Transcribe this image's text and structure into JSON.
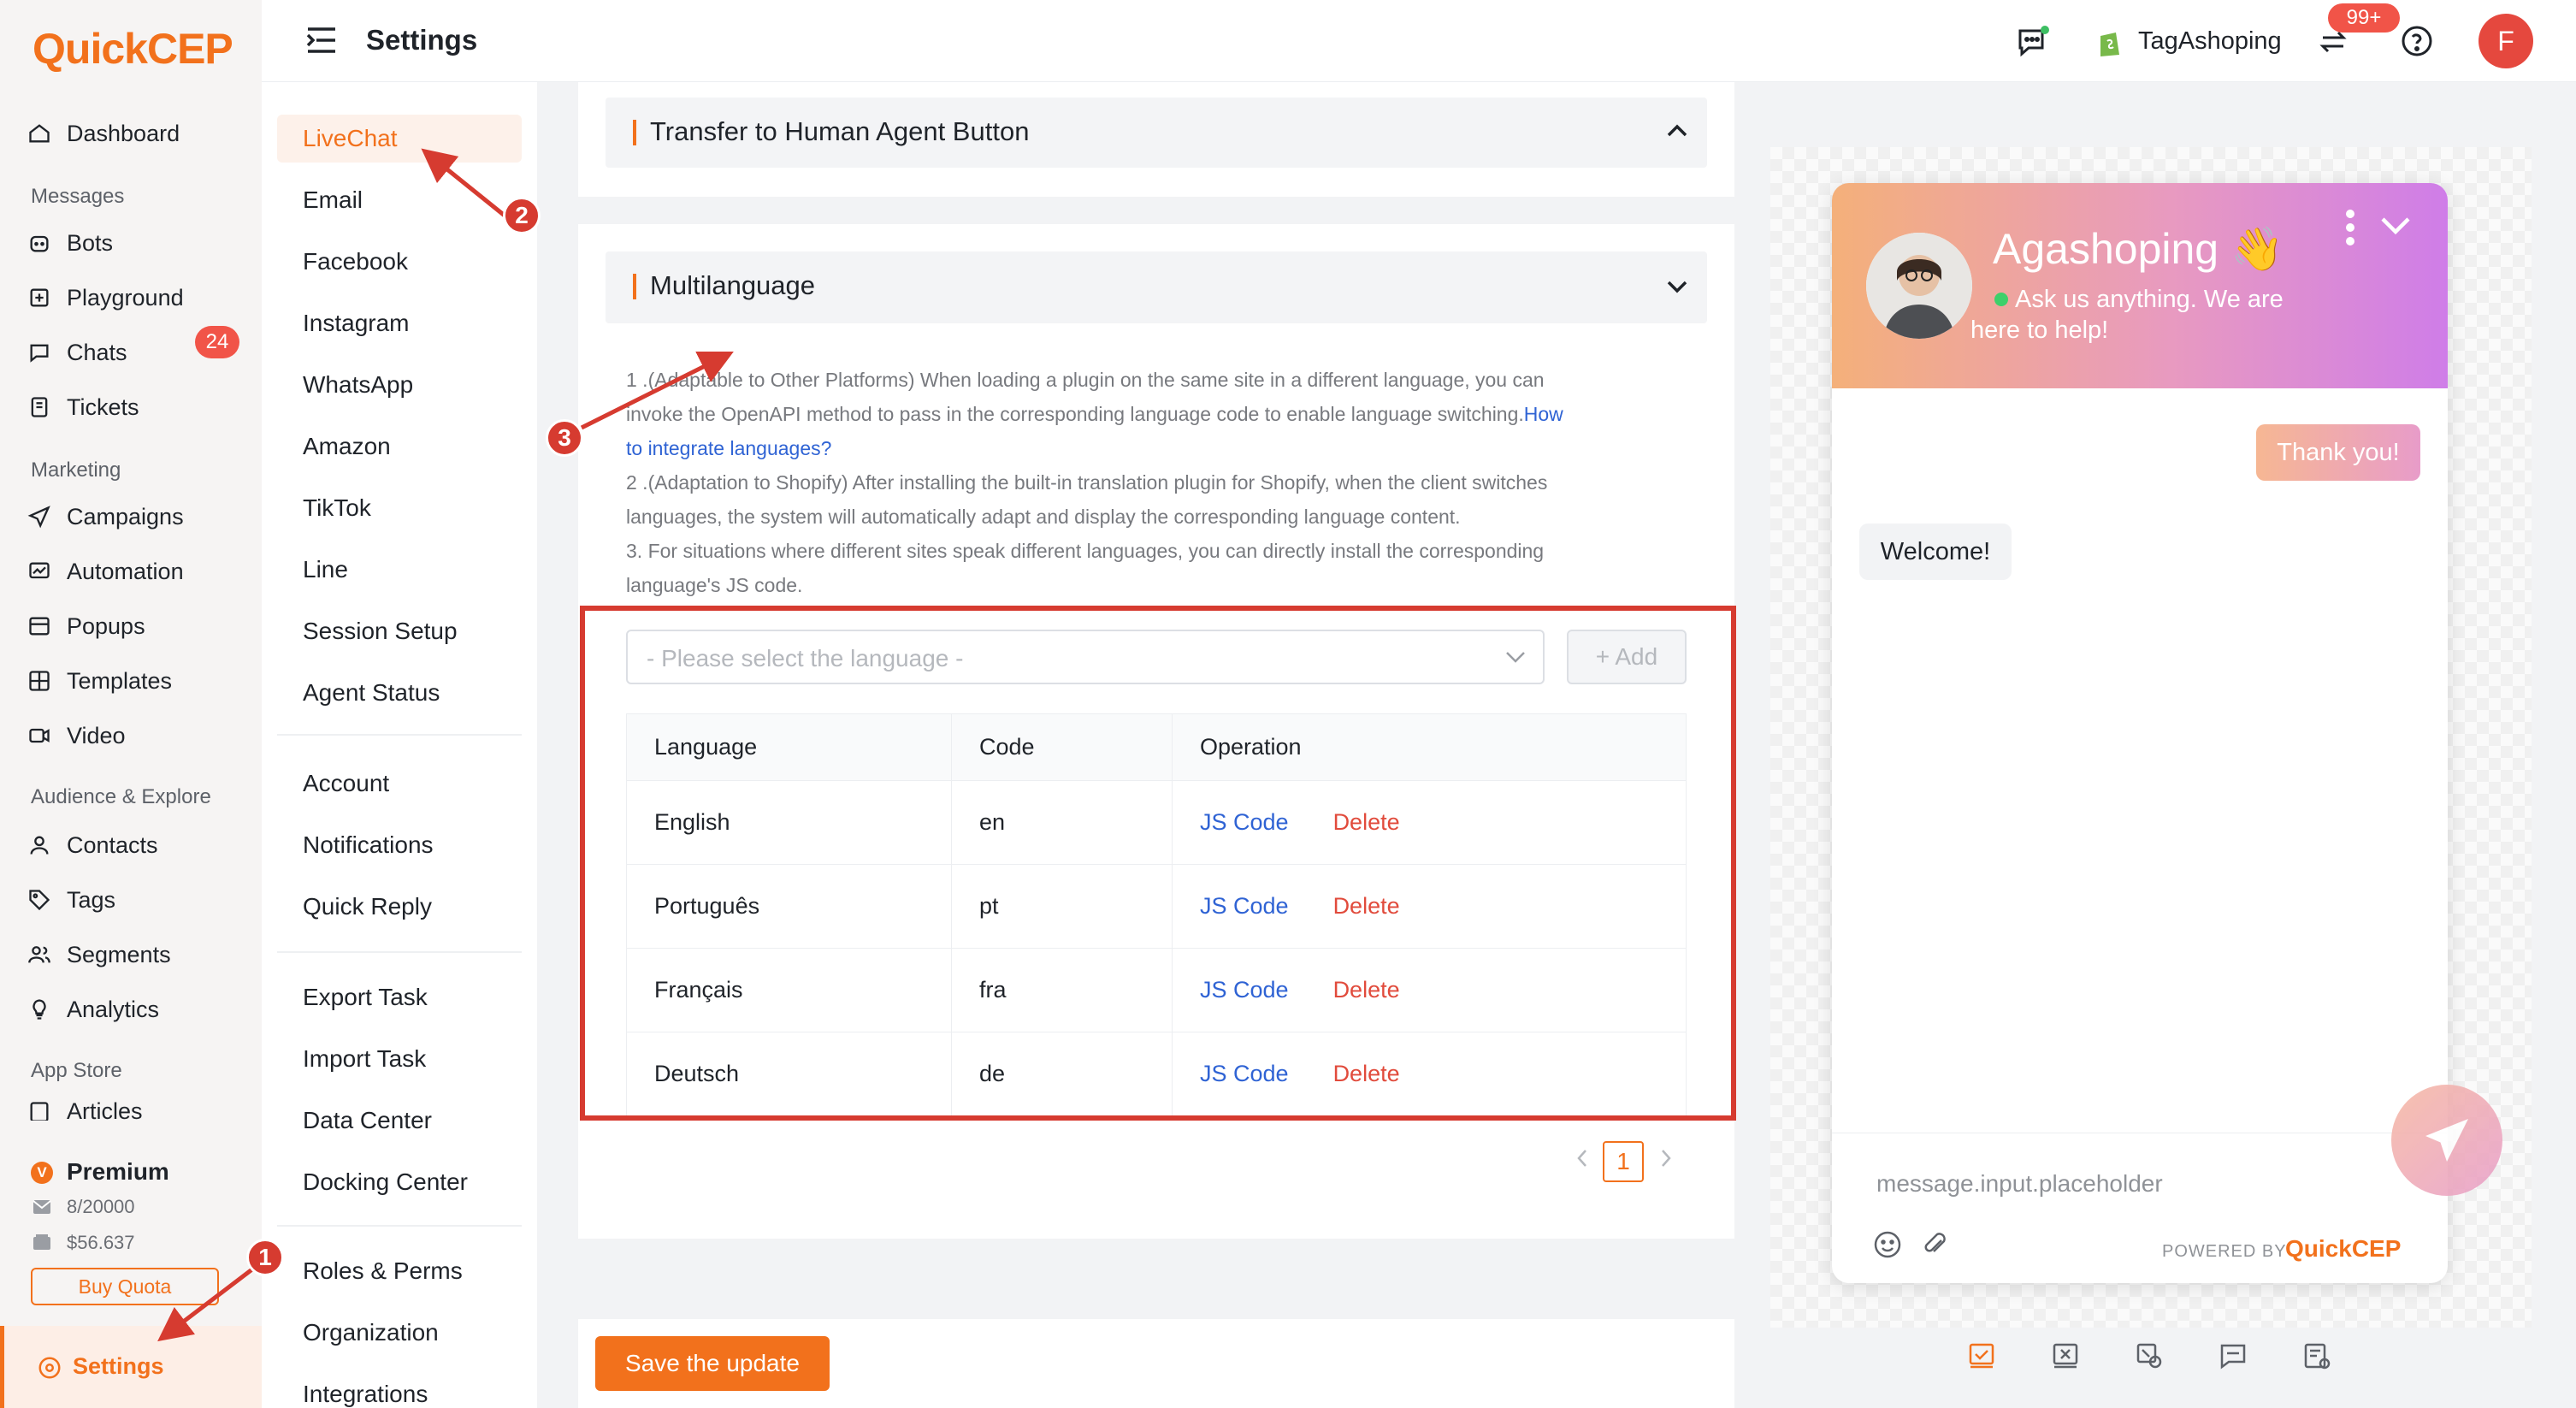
{
  "app": {
    "logo_first": "Q",
    "logo_mid": "uick",
    "logo_end": "CEP",
    "page_title": "Settings"
  },
  "leftnav": {
    "dashboard": "Dashboard",
    "sec_messages": "Messages",
    "bots": "Bots",
    "playground": "Playground",
    "chats": "Chats",
    "chats_badge": "24",
    "tickets": "Tickets",
    "sec_marketing": "Marketing",
    "campaigns": "Campaigns",
    "automation": "Automation",
    "popups": "Popups",
    "templates": "Templates",
    "video": "Video",
    "sec_audience": "Audience & Explore",
    "contacts": "Contacts",
    "tags": "Tags",
    "segments": "Segments",
    "analytics": "Analytics",
    "sec_appstore": "App Store",
    "articles": "Articles",
    "plan": "Premium",
    "quota_msgs": "8/20000",
    "quota_money": "$56.637",
    "buy_quota": "Buy Quota",
    "settings": "Settings"
  },
  "topbar": {
    "shop": "TagAshoping",
    "notif_badge": "99+",
    "avatar": "F"
  },
  "subnav": {
    "livechat": "LiveChat",
    "email": "Email",
    "facebook": "Facebook",
    "instagram": "Instagram",
    "whatsapp": "WhatsApp",
    "amazon": "Amazon",
    "tiktok": "TikTok",
    "line": "Line",
    "session": "Session Setup",
    "agent_status": "Agent Status",
    "account": "Account",
    "notifications": "Notifications",
    "quick_reply": "Quick Reply",
    "export": "Export Task",
    "import": "Import Task",
    "data_center": "Data Center",
    "docking": "Docking Center",
    "roles": "Roles & Perms",
    "org": "Organization",
    "integrations": "Integrations"
  },
  "main": {
    "transfer_title": "Transfer to Human Agent Button",
    "multi_title": "Multilanguage",
    "p1a": "1 .(Adaptable to Other Platforms) When loading a plugin on the same site in a different language, you can",
    "p1b": "invoke the OpenAPI method to pass in the corresponding language code to enable language switching.",
    "p1link_a": "How",
    "p1link_b": "to integrate languages?",
    "p2a": "2 .(Adaptation to Shopify) After installing the built-in translation plugin for Shopify, when the client switches",
    "p2b": "languages, the system will automatically adapt and display the corresponding language content.",
    "p3a": "3. For situations where different sites speak different languages, you can directly install the corresponding",
    "p3b": "language's JS code.",
    "select_placeholder": "- Please select the language -",
    "add_btn": "+ Add",
    "col_language": "Language",
    "col_code": "Code",
    "col_operation": "Operation",
    "rows": [
      {
        "lang": "English",
        "code": "en"
      },
      {
        "lang": "Português",
        "code": "pt"
      },
      {
        "lang": "Français",
        "code": "fra"
      },
      {
        "lang": "Deutsch",
        "code": "de"
      }
    ],
    "js_code": "JS Code",
    "delete": "Delete",
    "page": "1",
    "save": "Save the update"
  },
  "widget": {
    "name": "Agashoping 👋",
    "subtitle_a": "Ask us anything. We are",
    "subtitle_b": "here to help!",
    "msg_out": "Thank you!",
    "msg_in": "Welcome!",
    "input_placeholder": "message.input.placeholder",
    "powered_by": "POWERED BY",
    "brand_first": "Q",
    "brand_rest": "uick",
    "brand_end": "CEP"
  },
  "annotations": {
    "a1": "1",
    "a2": "2",
    "a3": "3"
  },
  "colors": {
    "accent": "#f2711c",
    "link": "#2f63d4",
    "danger": "#e14b3c",
    "highlight_box": "#d63b30"
  }
}
